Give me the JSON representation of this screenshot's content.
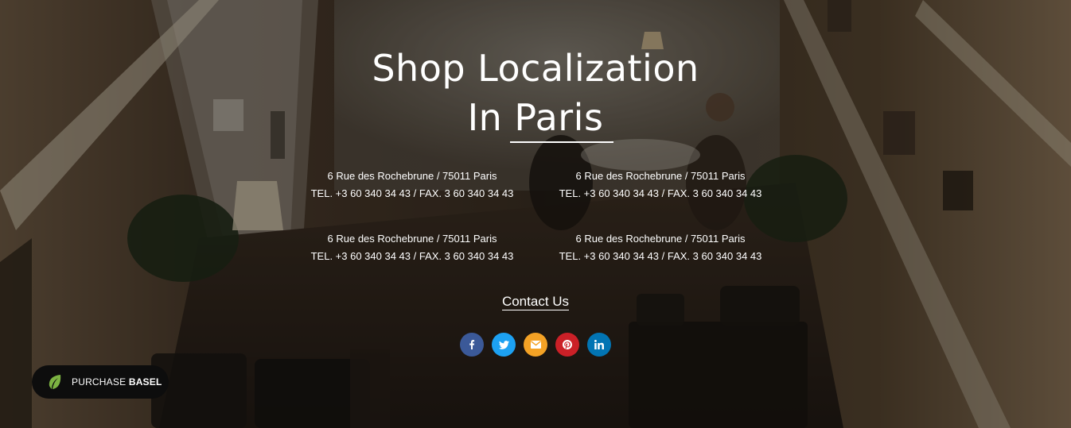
{
  "hero": {
    "title_line1": "Shop Localization",
    "title_line2": "In Paris"
  },
  "addresses": [
    {
      "street": "6 Rue des Rochebrune / 75011 Paris",
      "tel": "TEL. +3 60 340 34 43 / FAX. 3 60 340 34 43"
    },
    {
      "street": "6 Rue des Rochebrune / 75011 Paris",
      "tel": "TEL. +3 60 340 34 43 / FAX. 3 60 340 34 43"
    },
    {
      "street": "6 Rue des Rochebrune / 75011 Paris",
      "tel": "TEL. +3 60 340 34 43 / FAX. 3 60 340 34 43"
    },
    {
      "street": "6 Rue des Rochebrune / 75011 Paris",
      "tel": "TEL. +3 60 340 34 43 / FAX. 3 60 340 34 43"
    }
  ],
  "contact": {
    "label": "Contact Us"
  },
  "social": [
    {
      "icon": "facebook-icon",
      "color": "#3b5998"
    },
    {
      "icon": "twitter-icon",
      "color": "#1da1f2"
    },
    {
      "icon": "email-icon",
      "color": "#f4a225"
    },
    {
      "icon": "pinterest-icon",
      "color": "#cb2027"
    },
    {
      "icon": "linkedin-icon",
      "color": "#0274b3"
    }
  ],
  "purchase": {
    "prefix": "PURCHASE",
    "brand": "BASEL",
    "icon": "leaf-icon",
    "icon_color": "#7cb342"
  }
}
